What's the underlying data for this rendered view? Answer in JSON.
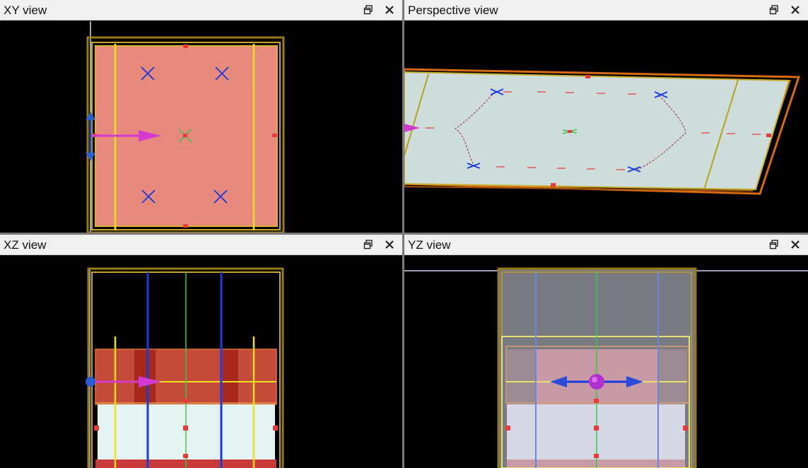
{
  "panes": {
    "xy": {
      "title": "XY view"
    },
    "perspective": {
      "title": "Perspective view"
    },
    "xz": {
      "title": "XZ view"
    },
    "yz": {
      "title": "YZ view"
    }
  },
  "icons": {
    "restore": "restore-window-icon",
    "close": "close-icon"
  },
  "colors": {
    "background": "#000000",
    "outline_gold": "#b8901c",
    "guide_yellow": "#f0e020",
    "selection_pink": "#e8897e",
    "arrow_magenta": "#d43ad0",
    "axis_blue": "#1a3adc",
    "axis_green": "#3ac84a",
    "handle_red": "#e83a3a",
    "plane_gray": "#cfdcdc"
  }
}
